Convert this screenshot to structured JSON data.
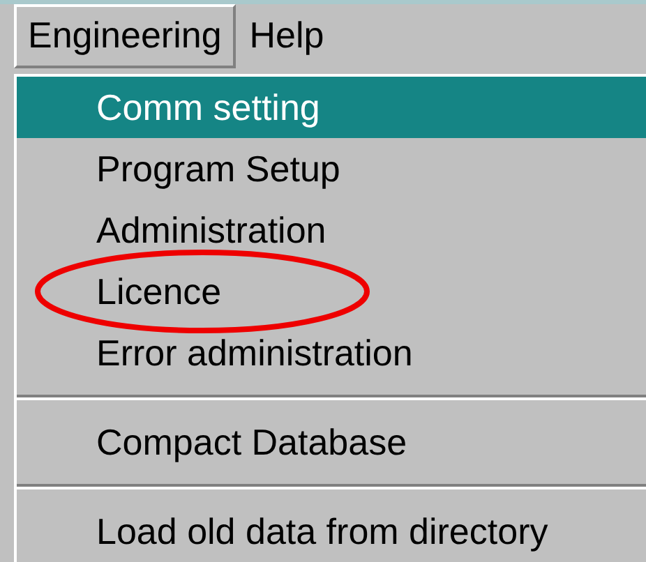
{
  "menubar": [
    {
      "label": "Engineering",
      "selected": true
    },
    {
      "label": "Help",
      "selected": false
    }
  ],
  "menu": {
    "items": [
      {
        "kind": "item",
        "label": "Comm setting",
        "selected": true,
        "circled": false
      },
      {
        "kind": "item",
        "label": "Program Setup",
        "selected": false,
        "circled": false
      },
      {
        "kind": "item",
        "label": "Administration",
        "selected": false,
        "circled": false
      },
      {
        "kind": "item",
        "label": "Licence",
        "selected": false,
        "circled": true
      },
      {
        "kind": "item",
        "label": "Error administration",
        "selected": false,
        "circled": false
      },
      {
        "kind": "separator"
      },
      {
        "kind": "item",
        "label": "Compact Database",
        "selected": false,
        "circled": false
      },
      {
        "kind": "separator"
      },
      {
        "kind": "item",
        "label": "Load old data from directory",
        "selected": false,
        "circled": false
      }
    ]
  }
}
